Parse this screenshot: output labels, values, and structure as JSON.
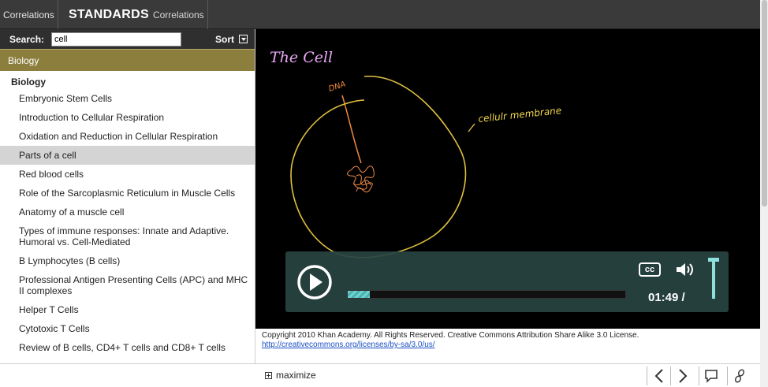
{
  "tabs": {
    "correlations": "Correlations",
    "standards_bold": "STANDARDS",
    "standards_rest": "Correlations"
  },
  "search": {
    "label": "Search:",
    "value": "cell",
    "sort_label": "Sort"
  },
  "category": "Biology",
  "group_title": "Biology",
  "items": [
    "Embryonic Stem Cells",
    "Introduction to Cellular Respiration",
    "Oxidation and Reduction in Cellular Respiration",
    "Parts of a cell",
    "Red blood cells",
    "Role of the Sarcoplasmic Reticulum in Muscle Cells",
    "Anatomy of a muscle cell",
    "Types of immune responses: Innate and Adaptive. Humoral vs. Cell-Mediated",
    "B Lymphocytes (B cells)",
    "Professional Antigen Presenting Cells (APC) and MHC II complexes",
    "Helper T Cells",
    "Cytotoxic T Cells",
    "Review of B cells, CD4+ T cells and CD8+ T cells"
  ],
  "selected_item": "Parts of a cell",
  "video": {
    "title_text": "The Cell",
    "dna_label": "DNA",
    "membrane_label": "cellulr membrane",
    "time": "01:49 /",
    "cc_label": "cc",
    "progress": 0.08
  },
  "copyright": {
    "text": "Copyright 2010 Khan Academy. All Rights Reserved. Creative Commons Attribution Share Alike 3.0 License.",
    "link": "http://creativecommons.org/licenses/by-sa/3.0/us/"
  },
  "bottom": {
    "maximize_label": "maximize"
  },
  "colors": {
    "category_bg": "#8c7e3d",
    "controls_bg": "#284442",
    "accent": "#8ee0dd",
    "selected_row": "#d4d4d4"
  },
  "icons": [
    "sort-icon",
    "play-icon",
    "cc-icon",
    "volume-icon",
    "maximize-icon",
    "chevron-left-icon",
    "chevron-right-icon",
    "comment-icon",
    "link-icon"
  ]
}
